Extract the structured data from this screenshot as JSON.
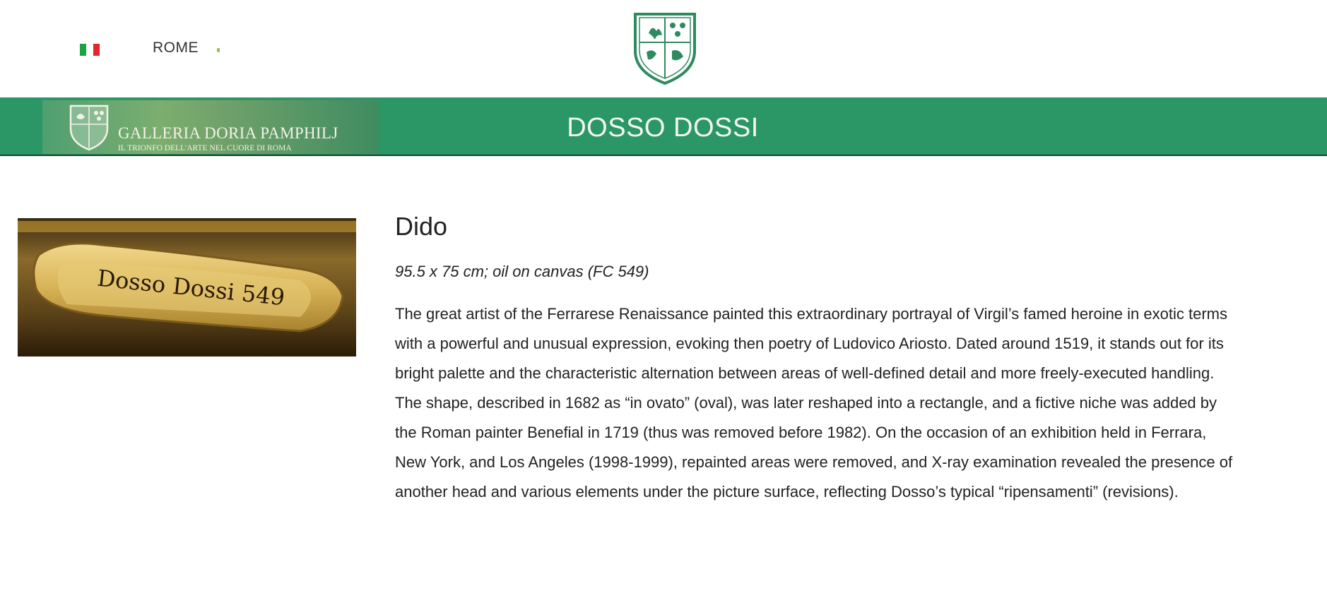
{
  "header": {
    "language_flag": "italian-flag-icon",
    "city": "ROME",
    "crest": "galleria-crest-logo"
  },
  "banner": {
    "logo_title": "GALLERIA DORIA PAMPHILJ",
    "logo_subtitle": "IL TRIONFO DELL'ARTE NEL CUORE DI ROMA",
    "artist": "DOSSO DOSSI"
  },
  "artwork": {
    "thumbnail_label": "Dosso Dossi 549",
    "title": "Dido",
    "meta": "95.5 x 75 cm; oil on canvas (FC 549)",
    "description": "The great artist of the Ferrarese Renaissance painted this extraordinary portrayal of Virgil’s famed heroine in exotic terms with a powerful and unusual expression, evoking then poetry of Ludovico Ariosto. Dated around 1519, it stands out for its bright palette and the characteristic alternation between areas of well-defined detail and more freely-executed handling. The shape, described in 1682 as “in ovato” (oval), was later reshaped into a rectangle, and a fictive niche was added by the Roman painter Benefial in 1719 (thus was removed before 1982). On the occasion of an exhibition held in Ferrara, New York, and Los Angeles (1998-1999), repainted areas were removed, and X-ray examination revealed the presence of another head and various elements under the picture surface, reflecting Dosso’s typical “ripensamenti” (revisions)."
  },
  "colors": {
    "brand_green": "#2b9766",
    "crest_green": "#2e8b5f",
    "gold": "#c9a23a"
  }
}
